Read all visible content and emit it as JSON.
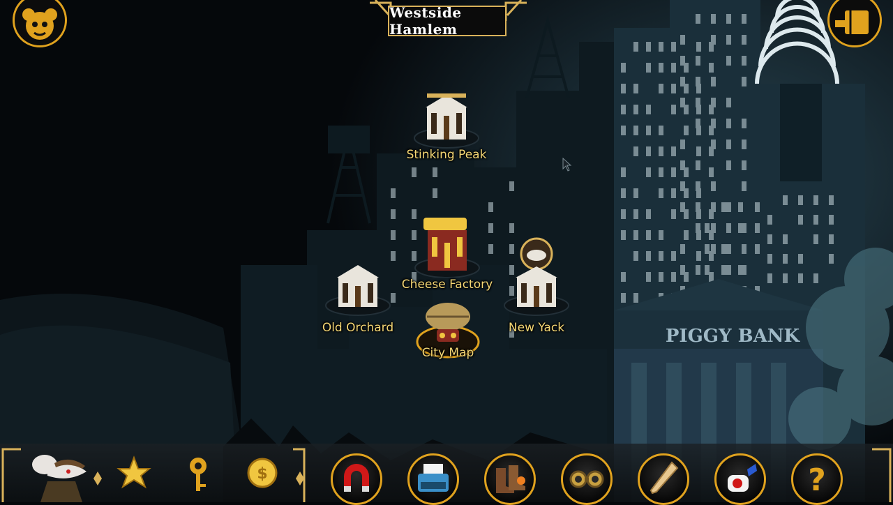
{
  "location": {
    "title": "Westside Hamlem"
  },
  "map": {
    "bank_sign": "PIGGY BANK",
    "markers": [
      {
        "id": "stinking-peak",
        "label": "Stinking Peak",
        "icon": "bank-building-icon"
      },
      {
        "id": "cheese-factory",
        "label": "Cheese Factory",
        "icon": "cheese-factory-icon"
      },
      {
        "id": "old-orchard",
        "label": "Old Orchard",
        "icon": "bank-building-icon"
      },
      {
        "id": "new-yack",
        "label": "New Yack",
        "icon": "bank-building-icon"
      },
      {
        "id": "city-map",
        "label": "City Map",
        "icon": "airship-icon"
      }
    ]
  },
  "hud": {
    "menu_icon": "mouse-face-menu-icon",
    "journal_icon": "map-journal-icon",
    "player_icon": "mouse-detective-portrait-icon",
    "stats": [
      "star-badge-icon",
      "key-icon",
      "coin-icon"
    ],
    "inventory": [
      {
        "id": "magnet",
        "icon": "magnet-icon"
      },
      {
        "id": "typewriter",
        "icon": "typewriter-icon"
      },
      {
        "id": "boots",
        "icon": "rocket-boots-icon"
      },
      {
        "id": "goggles",
        "icon": "goggles-icon"
      },
      {
        "id": "bat",
        "icon": "baseball-bat-icon"
      },
      {
        "id": "gadget",
        "icon": "spray-gadget-icon"
      },
      {
        "id": "help",
        "icon": "question-mark-icon",
        "label": "?"
      }
    ]
  },
  "colors": {
    "accent": "#e0a21e",
    "label": "#f3d675",
    "sky": "#05080b",
    "city": "#1d3340"
  }
}
